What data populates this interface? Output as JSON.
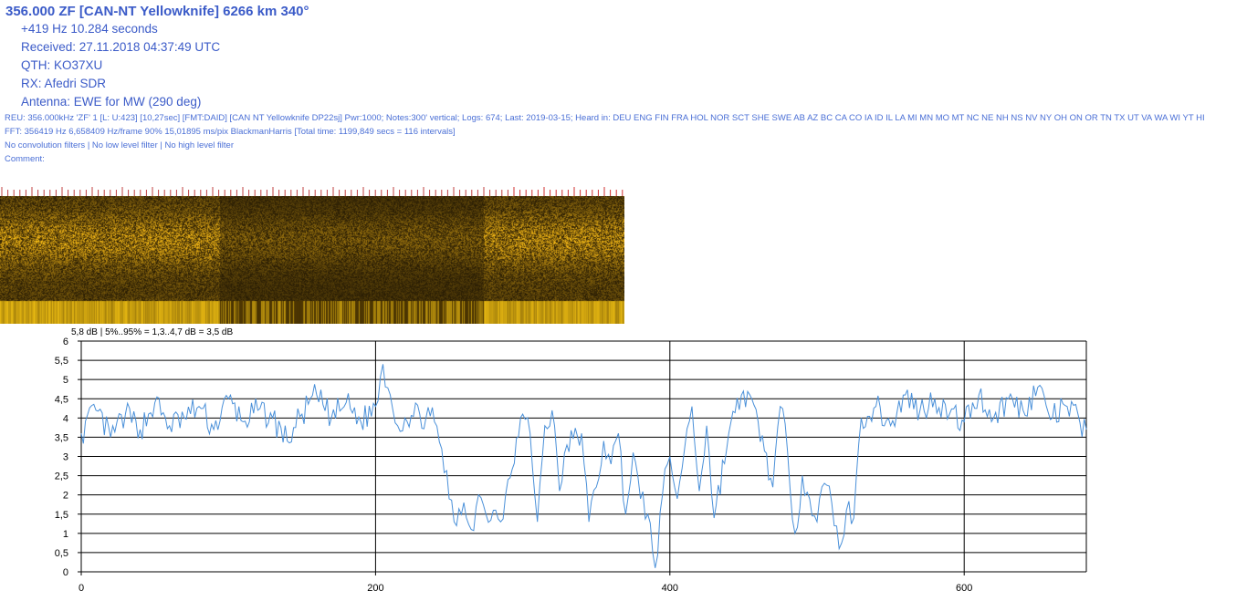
{
  "header": {
    "title": "356.000 ZF [CAN-NT Yellowknife] 6266 km 340°",
    "offset": "+419 Hz 10.284 seconds",
    "received": "Received: 27.11.2018 04:37:49 UTC",
    "qth": "QTH: KO37XU",
    "rx": "RX: Afedri SDR",
    "antenna": "Antenna: EWE for MW (290 deg)"
  },
  "details": {
    "reu": "REU: 356.000kHz 'ZF' 1 [L: U:423] [10,27sec] [FMT:DAID] [CAN NT Yellowknife DP22sj] Pwr:1000; Notes:300' vertical; Logs: 674; Last: 2019-03-15; Heard in: DEU ENG FIN FRA HOL NOR SCT SHE SWE AB AZ BC CA CO IA ID IL LA MI MN MO MT NC NE NH NS NV NY OH ON OR TN TX UT VA WA WI YT HI",
    "fft": "FFT: 356419 Hz 6,658409 Hz/frame 90% 15,01895 ms/pix BlackmanHarris [Total time: 1199,849 secs = 116 intervals]",
    "filters": "No convolution filters | No low level filter | No high level filter",
    "comment": "Comment:"
  },
  "colors": {
    "header_text": "#3b5bc8",
    "detail_text": "#4a6fd6",
    "line": "#4a90d9",
    "grid": "#000000",
    "spectrogram_gold": "#e0b400"
  },
  "chart_data": {
    "type": "line",
    "title": "5,8 dB | 5%..95% = 1,3..4,7 dB = 3,5 dB",
    "xlabel": "",
    "ylabel": "",
    "xlim": [
      0,
      683
    ],
    "ylim": [
      0,
      6
    ],
    "xticks": [
      0,
      200,
      400,
      600
    ],
    "yticks": [
      "0",
      "0,5",
      "1",
      "1,5",
      "2",
      "2,5",
      "3",
      "3,5",
      "4",
      "4,5",
      "5",
      "5,5",
      "6"
    ],
    "grid": true,
    "series": [
      {
        "name": "",
        "x": [
          0,
          10,
          20,
          30,
          40,
          50,
          60,
          70,
          80,
          90,
          100,
          110,
          120,
          130,
          140,
          150,
          160,
          170,
          180,
          190,
          200,
          205,
          210,
          215,
          220,
          230,
          240,
          245,
          250,
          255,
          260,
          265,
          270,
          275,
          280,
          285,
          290,
          300,
          305,
          310,
          315,
          320,
          325,
          330,
          340,
          345,
          350,
          355,
          360,
          365,
          370,
          375,
          380,
          385,
          390,
          395,
          400,
          405,
          410,
          415,
          420,
          425,
          430,
          440,
          450,
          460,
          470,
          475,
          480,
          485,
          490,
          495,
          500,
          505,
          510,
          515,
          520,
          525,
          530,
          540,
          550,
          560,
          570,
          580,
          590,
          600,
          610,
          620,
          630,
          640,
          650,
          660,
          670,
          683
        ],
        "y": [
          3.6,
          4.2,
          3.5,
          4.1,
          3.7,
          4.4,
          3.8,
          4.0,
          4.3,
          3.7,
          4.5,
          3.9,
          4.2,
          4.0,
          3.4,
          4.1,
          4.6,
          4.0,
          4.4,
          3.9,
          4.3,
          5.4,
          4.6,
          3.8,
          4.0,
          4.1,
          3.9,
          3.2,
          1.9,
          1.2,
          1.8,
          1.1,
          2.0,
          1.5,
          1.6,
          1.3,
          2.4,
          4.1,
          3.6,
          1.3,
          3.8,
          4.2,
          2.1,
          3.3,
          3.6,
          1.3,
          2.2,
          3.4,
          2.8,
          3.6,
          1.5,
          3.1,
          1.9,
          1.5,
          0.1,
          2.0,
          3.0,
          1.9,
          3.2,
          4.3,
          2.1,
          3.8,
          1.4,
          3.6,
          4.7,
          3.9,
          2.2,
          4.3,
          3.1,
          1.0,
          2.5,
          1.9,
          1.3,
          2.3,
          1.8,
          0.6,
          1.6,
          1.4,
          4.0,
          4.3,
          3.8,
          4.6,
          4.2,
          4.5,
          4.1,
          3.9,
          4.6,
          4.0,
          4.5,
          4.2,
          4.8,
          4.0,
          4.3,
          3.7
        ]
      }
    ]
  }
}
